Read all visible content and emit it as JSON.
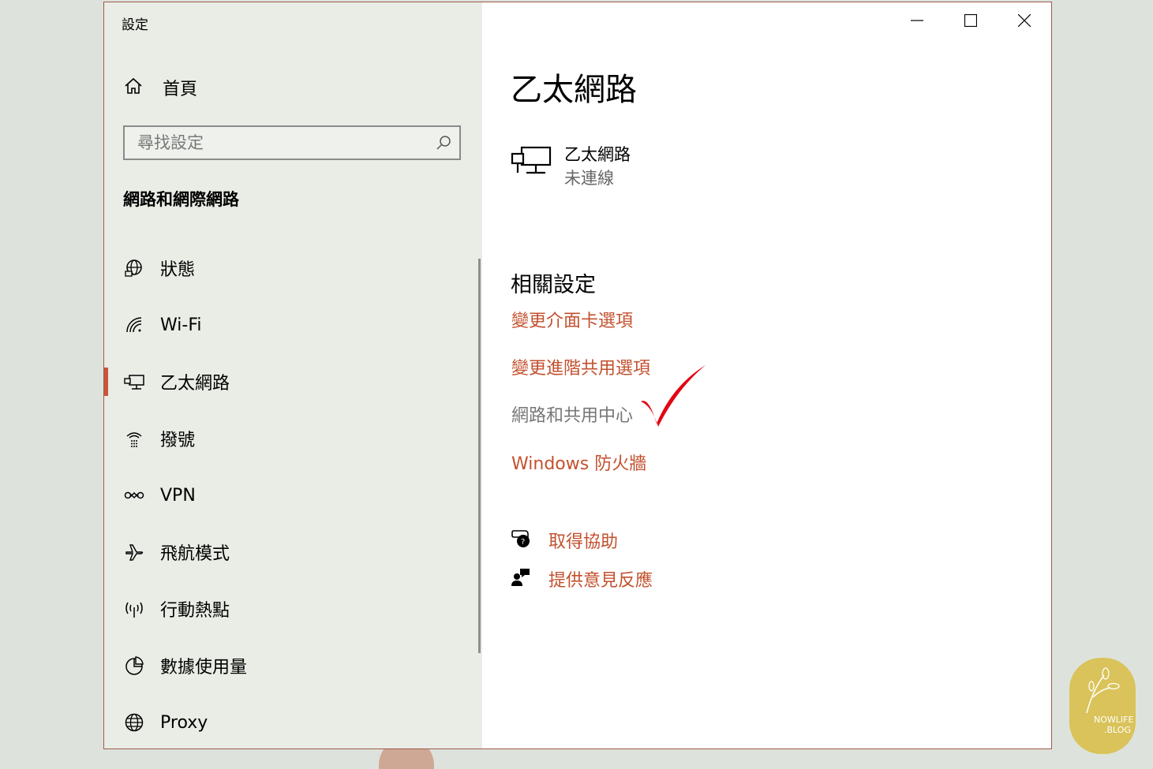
{
  "window": {
    "title": "設定",
    "minimize_label": "Minimize",
    "maximize_label": "Maximize",
    "close_label": "Close"
  },
  "sidebar": {
    "home_label": "首頁",
    "search": {
      "placeholder": "尋找設定",
      "value": ""
    },
    "section_title": "網路和網際網路",
    "items": [
      {
        "label": "狀態",
        "icon": "globe-status-icon"
      },
      {
        "label": "Wi-Fi",
        "icon": "wifi-icon"
      },
      {
        "label": "乙太網路",
        "icon": "ethernet-icon",
        "selected": true
      },
      {
        "label": "撥號",
        "icon": "dialup-icon"
      },
      {
        "label": "VPN",
        "icon": "vpn-icon"
      },
      {
        "label": "飛航模式",
        "icon": "airplane-icon"
      },
      {
        "label": "行動熱點",
        "icon": "hotspot-icon"
      },
      {
        "label": "數據使用量",
        "icon": "data-usage-icon"
      },
      {
        "label": "Proxy",
        "icon": "proxy-globe-icon"
      }
    ]
  },
  "main": {
    "title": "乙太網路",
    "connection": {
      "name": "乙太網路",
      "status": "未連線",
      "icon": "ethernet-icon"
    },
    "related_title": "相關設定",
    "related_links": [
      "變更介面卡選項",
      "變更進階共用選項",
      "網路和共用中心",
      "Windows 防火牆"
    ],
    "help": [
      {
        "label": "取得協助",
        "icon": "help-chat-icon"
      },
      {
        "label": "提供意見反應",
        "icon": "feedback-icon"
      }
    ]
  },
  "colors": {
    "accent": "#c3512f",
    "selection_bar": "#c8553a",
    "sidebar_bg": "#e9ede6",
    "checkmark": "#e30613"
  },
  "watermark": {
    "line1": "NOWLIFE",
    "line2": ".BLOG"
  }
}
